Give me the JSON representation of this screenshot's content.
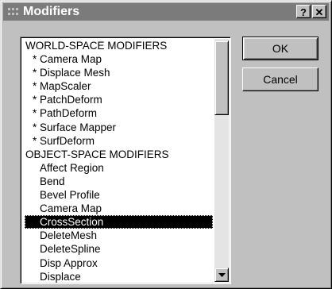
{
  "window": {
    "title": "Modifiers"
  },
  "titlebar": {
    "help_label": "?",
    "close_label": "✕"
  },
  "modifiers": {
    "items": [
      {
        "label": "WORLD-SPACE MODIFIERS",
        "kind": "header"
      },
      {
        "label": "* Camera Map",
        "kind": "sub"
      },
      {
        "label": "* Displace Mesh",
        "kind": "sub"
      },
      {
        "label": "* MapScaler",
        "kind": "sub"
      },
      {
        "label": "* PatchDeform",
        "kind": "sub"
      },
      {
        "label": "* PathDeform",
        "kind": "sub"
      },
      {
        "label": "* Surface Mapper",
        "kind": "sub"
      },
      {
        "label": "* SurfDeform",
        "kind": "sub"
      },
      {
        "label": "OBJECT-SPACE MODIFIERS",
        "kind": "header"
      },
      {
        "label": "Affect Region",
        "kind": "plain"
      },
      {
        "label": "Bend",
        "kind": "plain"
      },
      {
        "label": "Bevel Profile",
        "kind": "plain"
      },
      {
        "label": "Camera Map",
        "kind": "plain"
      },
      {
        "label": "CrossSection",
        "kind": "plain",
        "selected": true
      },
      {
        "label": "DeleteMesh",
        "kind": "plain"
      },
      {
        "label": "DeleteSpline",
        "kind": "plain"
      },
      {
        "label": "Disp Approx",
        "kind": "plain"
      },
      {
        "label": "Displace",
        "kind": "plain"
      }
    ]
  },
  "buttons": {
    "ok_label": "OK",
    "cancel_label": "Cancel"
  },
  "colors": {
    "titlebar": "#7b7b7b",
    "face": "#c0c0c0",
    "selection": "#000000"
  }
}
